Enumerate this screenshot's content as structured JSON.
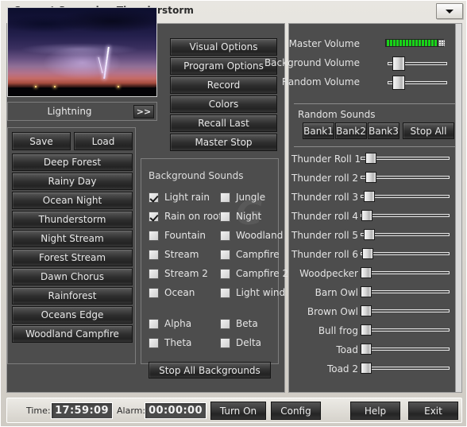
{
  "window": {
    "title": "Current Scenario - Thunderstorm",
    "dropdown_icon": "chevron-down-icon"
  },
  "preview": {
    "caption": "Lightning",
    "next_label": ">>"
  },
  "center_buttons": [
    {
      "label": "Visual Options",
      "name": "visual-options-button"
    },
    {
      "label": "Program Options",
      "name": "program-options-button"
    },
    {
      "label": "Record",
      "name": "record-button"
    },
    {
      "label": "Colors",
      "name": "colors-button"
    },
    {
      "label": "Recall Last",
      "name": "recall-last-button"
    },
    {
      "label": "Master Stop",
      "name": "master-stop-button"
    }
  ],
  "scenarios": {
    "save_label": "Save",
    "load_label": "Load",
    "items": [
      "Deep Forest",
      "Rainy Day",
      "Ocean Night",
      "Thunderstorm",
      "Night Stream",
      "Forest Stream",
      "Dawn Chorus",
      "Rainforest",
      "Oceans Edge",
      "Woodland Campfire"
    ],
    "selected": "Thunderstorm"
  },
  "background_sounds": {
    "title": "Background Sounds",
    "watermark": "G",
    "stop_all_label": "Stop All Backgrounds",
    "left_column": [
      {
        "label": "Light rain",
        "checked": true
      },
      {
        "label": "Rain on roof",
        "checked": true
      },
      {
        "label": "Fountain",
        "checked": false
      },
      {
        "label": "Stream",
        "checked": false
      },
      {
        "label": "Stream 2",
        "checked": false
      },
      {
        "label": "Ocean",
        "checked": false
      }
    ],
    "right_column": [
      {
        "label": "Jungle",
        "checked": false
      },
      {
        "label": "Night",
        "checked": false
      },
      {
        "label": "Woodland",
        "checked": false
      },
      {
        "label": "Campfire",
        "checked": false
      },
      {
        "label": "Campfire 2",
        "checked": false
      },
      {
        "label": "Light wind",
        "checked": false
      }
    ],
    "wave_left": [
      {
        "label": "Alpha",
        "checked": false
      },
      {
        "label": "Theta",
        "checked": false
      }
    ],
    "wave_right": [
      {
        "label": "Beta",
        "checked": false
      },
      {
        "label": "Delta",
        "checked": false
      }
    ]
  },
  "volumes": {
    "master": {
      "label": "Master Volume",
      "type": "led-meter",
      "segments": 17,
      "level_percent": 100
    },
    "background": {
      "label": "Background Volume",
      "value_percent": 12
    },
    "random": {
      "label": "Random Volume",
      "value_percent": 12
    }
  },
  "random_sounds": {
    "title": "Random Sounds",
    "banks": [
      {
        "label": "Bank1",
        "name": "bank1-button"
      },
      {
        "label": "Bank2",
        "name": "bank2-button"
      },
      {
        "label": "Bank3",
        "name": "bank3-button"
      }
    ],
    "stop_all_label": "Stop All",
    "sliders": [
      {
        "label": "Thunder Roll 1",
        "value_percent": 5
      },
      {
        "label": "Thunder roll 2",
        "value_percent": 5
      },
      {
        "label": "Thunder roll 3",
        "value_percent": 3
      },
      {
        "label": "Thunder roll 4",
        "value_percent": 1
      },
      {
        "label": "Thunder roll 5",
        "value_percent": 3
      },
      {
        "label": "Thunder roll 6",
        "value_percent": 2
      },
      {
        "label": "Woodpecker",
        "value_percent": 0
      },
      {
        "label": "Barn Owl",
        "value_percent": 0
      },
      {
        "label": "Brown Owl",
        "value_percent": 0
      },
      {
        "label": "Bull frog",
        "value_percent": 0
      },
      {
        "label": "Toad",
        "value_percent": 0
      },
      {
        "label": "Toad 2",
        "value_percent": 0
      }
    ]
  },
  "statusbar": {
    "time_label": "Time:",
    "time_value": "17:59:09",
    "alarm_label": "Alarm:",
    "alarm_value": "00:00:00",
    "turn_on_label": "Turn On",
    "config_label": "Config",
    "help_label": "Help",
    "exit_label": "Exit"
  },
  "colors": {
    "panel_dark": "#4d4d4d",
    "frame_light": "#d4d0c8",
    "led_green": "#18d418",
    "text_light": "#e6e6e6"
  }
}
